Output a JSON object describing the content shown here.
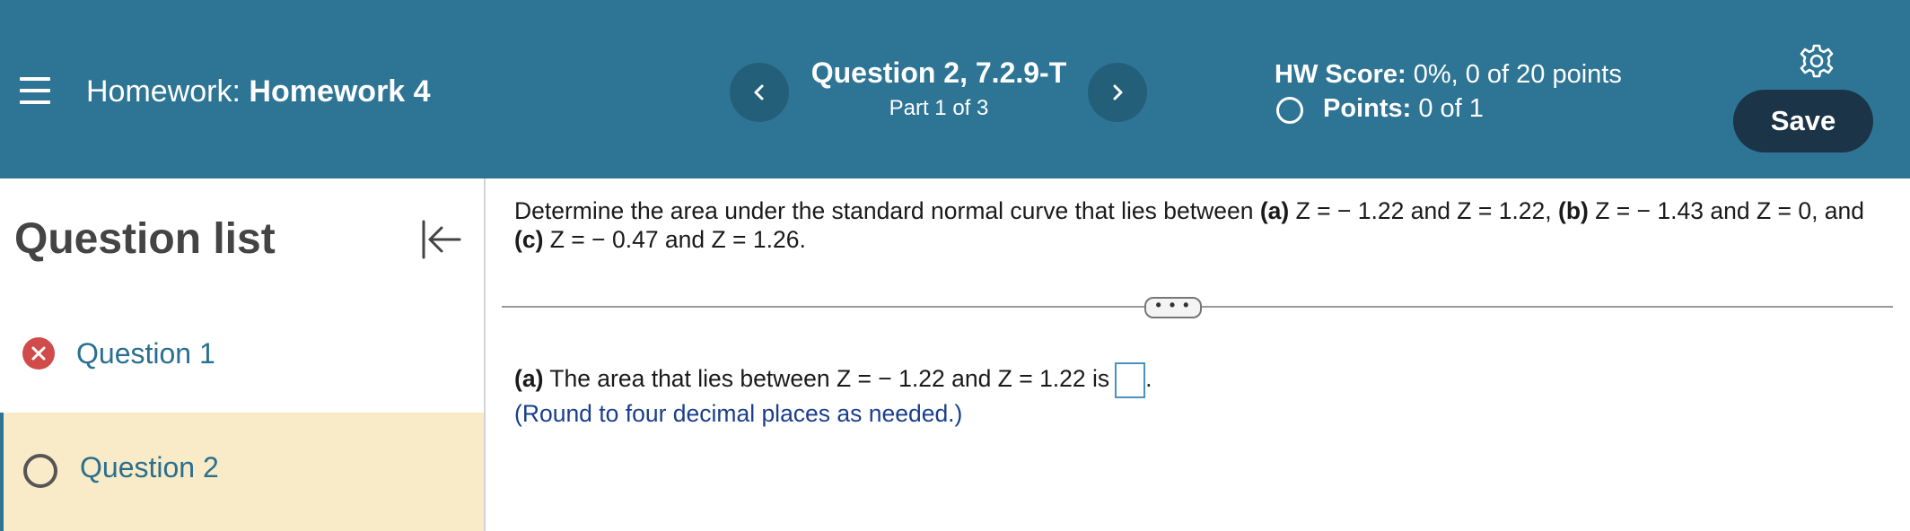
{
  "header": {
    "hw_label": "Homework:",
    "hw_name": "Homework 4",
    "question_title": "Question 2, 7.2.9-T",
    "question_part": "Part 1 of 3",
    "score_label": "HW Score:",
    "score_value": " 0%, 0 of 20 points",
    "points_label": "Points:",
    "points_value": " 0 of 1",
    "save_label": "Save",
    "icons": {
      "menu": "hamburger-menu-icon",
      "prev": "chevron-left-icon",
      "next": "chevron-right-icon",
      "settings": "gear-icon"
    },
    "colors": {
      "header_bg": "#2e7595",
      "save_bg": "#1b3447"
    }
  },
  "sidebar": {
    "title": "Question list",
    "collapse_icon": "collapse-left-icon",
    "items": [
      {
        "label": "Question 1",
        "status": "incorrect",
        "status_icon": "x-circle-icon"
      },
      {
        "label": "Question 2",
        "status": "current",
        "status_icon": "empty-circle-icon"
      }
    ]
  },
  "question": {
    "intro": "Determine the area under the standard normal curve that lies between ",
    "a_tag": "(a)",
    "a_range": " Z = − 1.22 and Z = 1.22, ",
    "b_tag": "(b)",
    "b_range": " Z = − 1.43 and Z = 0, and ",
    "c_tag": "(c)",
    "c_range": " Z = − 0.47 and Z = 1.26.",
    "expand_label": "• • •",
    "part_a_tag": "(a)",
    "part_a_text": " The area that lies between Z = − 1.22 and Z = 1.22 is",
    "part_a_end": ".",
    "answer_value": "",
    "hint": "(Round to four decimal places as needed.)"
  }
}
